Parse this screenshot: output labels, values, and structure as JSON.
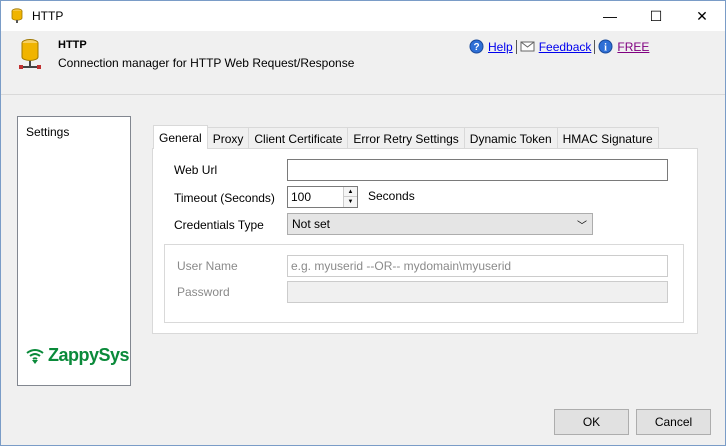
{
  "window": {
    "title": "HTTP",
    "minimize_glyph": "—",
    "maximize_glyph": "☐",
    "close_glyph": "✕"
  },
  "header": {
    "title": "HTTP",
    "subtitle": "Connection manager for HTTP Web Request/Response",
    "icon": "database-connection-icon"
  },
  "links": {
    "help": "Help",
    "feedback": "Feedback",
    "free": "FREE"
  },
  "sidebar": {
    "items": [
      {
        "label": "Settings"
      }
    ],
    "logo_text": "ZappySys"
  },
  "tabs": [
    {
      "label": "General",
      "active": true
    },
    {
      "label": "Proxy"
    },
    {
      "label": "Client Certificate"
    },
    {
      "label": "Error Retry Settings"
    },
    {
      "label": "Dynamic Token"
    },
    {
      "label": "HMAC Signature"
    }
  ],
  "form": {
    "web_url": {
      "label": "Web Url",
      "value": ""
    },
    "timeout": {
      "label": "Timeout (Seconds)",
      "value": "100",
      "unit": "Seconds"
    },
    "credentials_type": {
      "label": "Credentials Type",
      "value": "Not set"
    },
    "user_name": {
      "label": "User Name",
      "placeholder": "e.g. myuserid --OR-- mydomain\\myuserid"
    },
    "password": {
      "label": "Password"
    }
  },
  "buttons": {
    "ok": "OK",
    "cancel": "Cancel"
  },
  "colors": {
    "link": "#0000ee",
    "visited_link": "#800080",
    "logo_green": "#0a8a3a"
  }
}
